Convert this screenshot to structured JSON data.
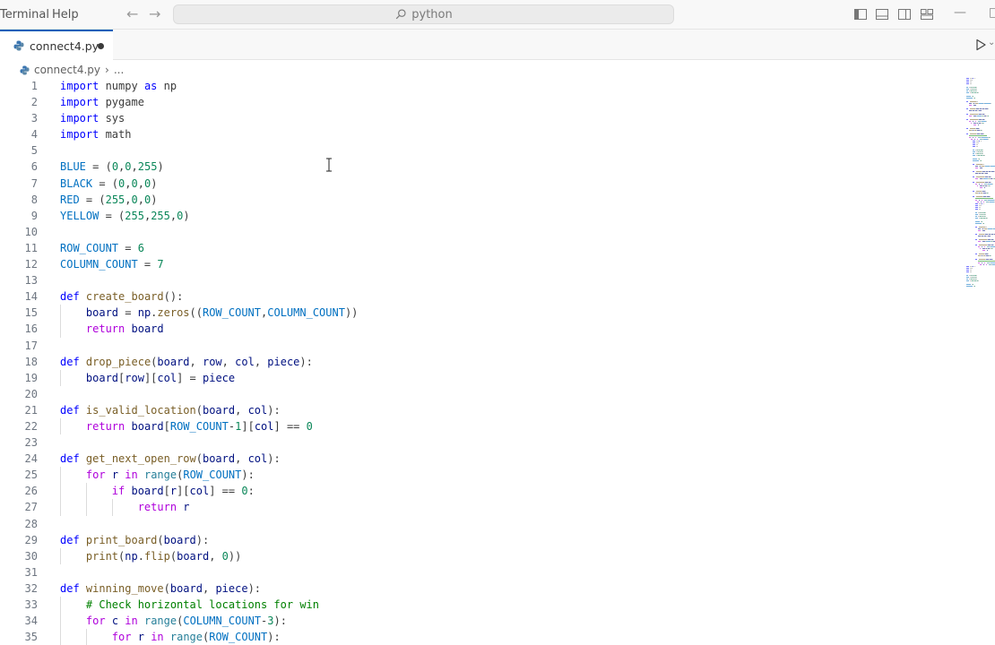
{
  "titlebar": {
    "menu": [
      "Terminal",
      "Help"
    ],
    "search_text": "python",
    "icons": [
      "arrow-left-icon",
      "arrow-right-icon",
      "search-icon",
      "toggle-primary-sidebar-icon",
      "toggle-panel-icon",
      "toggle-secondary-sidebar-icon",
      "customize-layout-icon",
      "minimize-icon",
      "restore-icon"
    ]
  },
  "tabs": [
    {
      "label": "connect4.py",
      "dirty": true,
      "icon": "python-file-icon"
    }
  ],
  "breadcrumb": {
    "file": "connect4.py",
    "separator": "›",
    "more": "..."
  },
  "colors": {
    "keyword": "#0000ff",
    "control": "#af00db",
    "function": "#795e26",
    "variable": "#001080",
    "constant": "#0070c1",
    "number": "#098658",
    "comment": "#008000",
    "accent": "#005fb8"
  },
  "editor": {
    "lines": [
      [
        [
          "kw",
          "import"
        ],
        [
          "t",
          " numpy "
        ],
        [
          "kw",
          "as"
        ],
        [
          "t",
          " np"
        ]
      ],
      [
        [
          "kw",
          "import"
        ],
        [
          "t",
          " pygame"
        ]
      ],
      [
        [
          "kw",
          "import"
        ],
        [
          "t",
          " sys"
        ]
      ],
      [
        [
          "kw",
          "import"
        ],
        [
          "t",
          " math"
        ]
      ],
      [],
      [
        [
          "const",
          "BLUE"
        ],
        [
          "t",
          " = ("
        ],
        [
          "num",
          "0"
        ],
        [
          "t",
          ","
        ],
        [
          "num",
          "0"
        ],
        [
          "t",
          ","
        ],
        [
          "num",
          "255"
        ],
        [
          "t",
          ")"
        ]
      ],
      [
        [
          "const",
          "BLACK"
        ],
        [
          "t",
          " = ("
        ],
        [
          "num",
          "0"
        ],
        [
          "t",
          ","
        ],
        [
          "num",
          "0"
        ],
        [
          "t",
          ","
        ],
        [
          "num",
          "0"
        ],
        [
          "t",
          ")"
        ]
      ],
      [
        [
          "const",
          "RED"
        ],
        [
          "t",
          " = ("
        ],
        [
          "num",
          "255"
        ],
        [
          "t",
          ","
        ],
        [
          "num",
          "0"
        ],
        [
          "t",
          ","
        ],
        [
          "num",
          "0"
        ],
        [
          "t",
          ")"
        ]
      ],
      [
        [
          "const",
          "YELLOW"
        ],
        [
          "t",
          " = ("
        ],
        [
          "num",
          "255"
        ],
        [
          "t",
          ","
        ],
        [
          "num",
          "255"
        ],
        [
          "t",
          ","
        ],
        [
          "num",
          "0"
        ],
        [
          "t",
          ")"
        ]
      ],
      [],
      [
        [
          "const",
          "ROW_COUNT"
        ],
        [
          "t",
          " = "
        ],
        [
          "num",
          "6"
        ]
      ],
      [
        [
          "const",
          "COLUMN_COUNT"
        ],
        [
          "t",
          " = "
        ],
        [
          "num",
          "7"
        ]
      ],
      [],
      [
        [
          "kw",
          "def"
        ],
        [
          "t",
          " "
        ],
        [
          "fn",
          "create_board"
        ],
        [
          "t",
          "():"
        ]
      ],
      [
        [
          "t",
          "    "
        ],
        [
          "var",
          "board"
        ],
        [
          "t",
          " = "
        ],
        [
          "var",
          "np"
        ],
        [
          "t",
          "."
        ],
        [
          "fn",
          "zeros"
        ],
        [
          "t",
          "(("
        ],
        [
          "const",
          "ROW_COUNT"
        ],
        [
          "t",
          ","
        ],
        [
          "const",
          "COLUMN_COUNT"
        ],
        [
          "t",
          "))"
        ]
      ],
      [
        [
          "t",
          "    "
        ],
        [
          "ctl",
          "return"
        ],
        [
          "t",
          " "
        ],
        [
          "var",
          "board"
        ]
      ],
      [],
      [
        [
          "kw",
          "def"
        ],
        [
          "t",
          " "
        ],
        [
          "fn",
          "drop_piece"
        ],
        [
          "t",
          "("
        ],
        [
          "var",
          "board"
        ],
        [
          "t",
          ", "
        ],
        [
          "var",
          "row"
        ],
        [
          "t",
          ", "
        ],
        [
          "var",
          "col"
        ],
        [
          "t",
          ", "
        ],
        [
          "var",
          "piece"
        ],
        [
          "t",
          "):"
        ]
      ],
      [
        [
          "t",
          "    "
        ],
        [
          "var",
          "board"
        ],
        [
          "t",
          "["
        ],
        [
          "var",
          "row"
        ],
        [
          "t",
          "]["
        ],
        [
          "var",
          "col"
        ],
        [
          "t",
          "] = "
        ],
        [
          "var",
          "piece"
        ]
      ],
      [],
      [
        [
          "kw",
          "def"
        ],
        [
          "t",
          " "
        ],
        [
          "fn",
          "is_valid_location"
        ],
        [
          "t",
          "("
        ],
        [
          "var",
          "board"
        ],
        [
          "t",
          ", "
        ],
        [
          "var",
          "col"
        ],
        [
          "t",
          "):"
        ]
      ],
      [
        [
          "t",
          "    "
        ],
        [
          "ctl",
          "return"
        ],
        [
          "t",
          " "
        ],
        [
          "var",
          "board"
        ],
        [
          "t",
          "["
        ],
        [
          "const",
          "ROW_COUNT"
        ],
        [
          "t",
          "-"
        ],
        [
          "num",
          "1"
        ],
        [
          "t",
          "]["
        ],
        [
          "var",
          "col"
        ],
        [
          "t",
          "] == "
        ],
        [
          "num",
          "0"
        ]
      ],
      [],
      [
        [
          "kw",
          "def"
        ],
        [
          "t",
          " "
        ],
        [
          "fn",
          "get_next_open_row"
        ],
        [
          "t",
          "("
        ],
        [
          "var",
          "board"
        ],
        [
          "t",
          ", "
        ],
        [
          "var",
          "col"
        ],
        [
          "t",
          "):"
        ]
      ],
      [
        [
          "t",
          "    "
        ],
        [
          "ctl",
          "for"
        ],
        [
          "t",
          " "
        ],
        [
          "var",
          "r"
        ],
        [
          "t",
          " "
        ],
        [
          "ctl",
          "in"
        ],
        [
          "t",
          " "
        ],
        [
          "cls",
          "range"
        ],
        [
          "t",
          "("
        ],
        [
          "const",
          "ROW_COUNT"
        ],
        [
          "t",
          "):"
        ]
      ],
      [
        [
          "t",
          "        "
        ],
        [
          "ctl",
          "if"
        ],
        [
          "t",
          " "
        ],
        [
          "var",
          "board"
        ],
        [
          "t",
          "["
        ],
        [
          "var",
          "r"
        ],
        [
          "t",
          "]["
        ],
        [
          "var",
          "col"
        ],
        [
          "t",
          "] == "
        ],
        [
          "num",
          "0"
        ],
        [
          "t",
          ":"
        ]
      ],
      [
        [
          "t",
          "            "
        ],
        [
          "ctl",
          "return"
        ],
        [
          "t",
          " "
        ],
        [
          "var",
          "r"
        ]
      ],
      [],
      [
        [
          "kw",
          "def"
        ],
        [
          "t",
          " "
        ],
        [
          "fn",
          "print_board"
        ],
        [
          "t",
          "("
        ],
        [
          "var",
          "board"
        ],
        [
          "t",
          "):"
        ]
      ],
      [
        [
          "t",
          "    "
        ],
        [
          "fn",
          "print"
        ],
        [
          "t",
          "("
        ],
        [
          "var",
          "np"
        ],
        [
          "t",
          "."
        ],
        [
          "fn",
          "flip"
        ],
        [
          "t",
          "("
        ],
        [
          "var",
          "board"
        ],
        [
          "t",
          ", "
        ],
        [
          "num",
          "0"
        ],
        [
          "t",
          "))"
        ]
      ],
      [],
      [
        [
          "kw",
          "def"
        ],
        [
          "t",
          " "
        ],
        [
          "fn",
          "winning_move"
        ],
        [
          "t",
          "("
        ],
        [
          "var",
          "board"
        ],
        [
          "t",
          ", "
        ],
        [
          "var",
          "piece"
        ],
        [
          "t",
          "):"
        ]
      ],
      [
        [
          "t",
          "    "
        ],
        [
          "cmt",
          "# Check horizontal locations for win"
        ]
      ],
      [
        [
          "t",
          "    "
        ],
        [
          "ctl",
          "for"
        ],
        [
          "t",
          " "
        ],
        [
          "var",
          "c"
        ],
        [
          "t",
          " "
        ],
        [
          "ctl",
          "in"
        ],
        [
          "t",
          " "
        ],
        [
          "cls",
          "range"
        ],
        [
          "t",
          "("
        ],
        [
          "const",
          "COLUMN_COUNT"
        ],
        [
          "t",
          "-"
        ],
        [
          "num",
          "3"
        ],
        [
          "t",
          "):"
        ]
      ],
      [
        [
          "t",
          "        "
        ],
        [
          "ctl",
          "for"
        ],
        [
          "t",
          " "
        ],
        [
          "var",
          "r"
        ],
        [
          "t",
          " "
        ],
        [
          "ctl",
          "in"
        ],
        [
          "t",
          " "
        ],
        [
          "cls",
          "range"
        ],
        [
          "t",
          "("
        ],
        [
          "const",
          "ROW_COUNT"
        ],
        [
          "t",
          "):"
        ]
      ]
    ]
  }
}
